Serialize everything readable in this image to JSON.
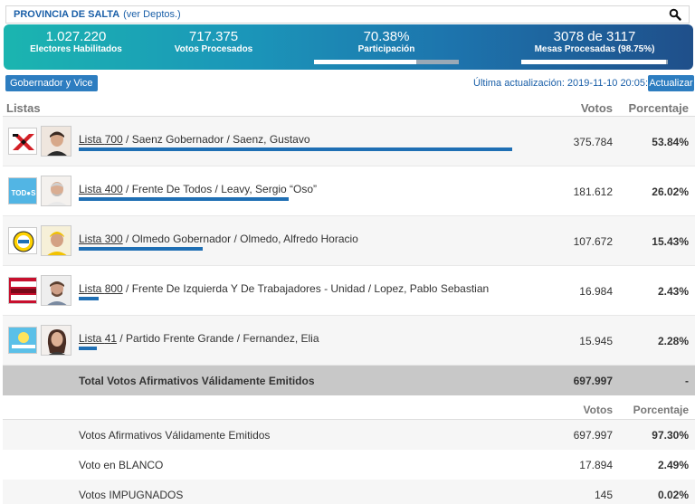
{
  "topbar": {
    "province": "PROVINCIA DE SALTA",
    "link": "(ver Deptos.)"
  },
  "stats": {
    "electores_value": "1.027.220",
    "electores_label": "Electores Habilitados",
    "votos_value": "717.375",
    "votos_label": "Votos Procesados",
    "participacion_value": "70.38%",
    "participacion_label": "Participación",
    "participacion_fraction": 0.7038,
    "mesas_value": "3078 de 3117",
    "mesas_label": "Mesas Procesadas (98.75%)",
    "mesas_fraction": 0.9875
  },
  "controls": {
    "cargo": "Gobernador y Vice",
    "updated": "Última actualización: 2019-11-10 20:05:01",
    "refresh": "Actualizar"
  },
  "header": {
    "listas": "Listas",
    "votos": "Votos",
    "porcentaje": "Porcentaje"
  },
  "rows": [
    {
      "prefix": "Lista ",
      "num": "700",
      "rest": " / Saenz Gobernador / Saenz, Gustavo",
      "votes": "375.784",
      "pct": "53.84%",
      "pct_value": 53.84,
      "logo_icon": "black-red-x-logo",
      "photo_icon": "candidate-photo"
    },
    {
      "prefix": "Lista ",
      "num": "400",
      "rest": " / Frente De Todos / Leavy, Sergio “Oso”",
      "votes": "181.612",
      "pct": "26.02%",
      "pct_value": 26.02,
      "logo_icon": "todos-logo",
      "photo_icon": "candidate-photo"
    },
    {
      "prefix": "Lista ",
      "num": "300",
      "rest": " / Olmedo Gobernador / Olmedo, Alfredo Horacio",
      "votes": "107.672",
      "pct": "15.43%",
      "pct_value": 15.43,
      "logo_icon": "olmedo-logo",
      "photo_icon": "candidate-photo"
    },
    {
      "prefix": "Lista ",
      "num": "800",
      "rest": " / Frente De Izquierda Y De Trabajadores - Unidad / Lopez, Pablo Sebastian",
      "votes": "16.984",
      "pct": "2.43%",
      "pct_value": 2.43,
      "logo_icon": "fit-logo",
      "photo_icon": "candidate-photo"
    },
    {
      "prefix": "Lista ",
      "num": "41",
      "rest": " / Partido Frente Grande / Fernandez, Elia",
      "votes": "15.945",
      "pct": "2.28%",
      "pct_value": 2.28,
      "logo_icon": "fernandez-logo",
      "photo_icon": "candidate-photo"
    }
  ],
  "total": {
    "label": "Total Votos Afirmativos Válidamente Emitidos",
    "votes": "697.997",
    "pct": "-"
  },
  "summary_header": {
    "votos": "Votos",
    "porcentaje": "Porcentaje"
  },
  "summary": [
    {
      "label": "Votos Afirmativos Válidamente Emitidos",
      "votes": "697.997",
      "pct": "97.30%"
    },
    {
      "label": "Voto en BLANCO",
      "votes": "17.894",
      "pct": "2.49%"
    },
    {
      "label": "Votos IMPUGNADOS",
      "votes": "145",
      "pct": "0.02%"
    }
  ],
  "colors": {
    "accent": "#1f6fb4",
    "banner_start": "#1bb5b0",
    "banner_end": "#1f4f8a"
  }
}
